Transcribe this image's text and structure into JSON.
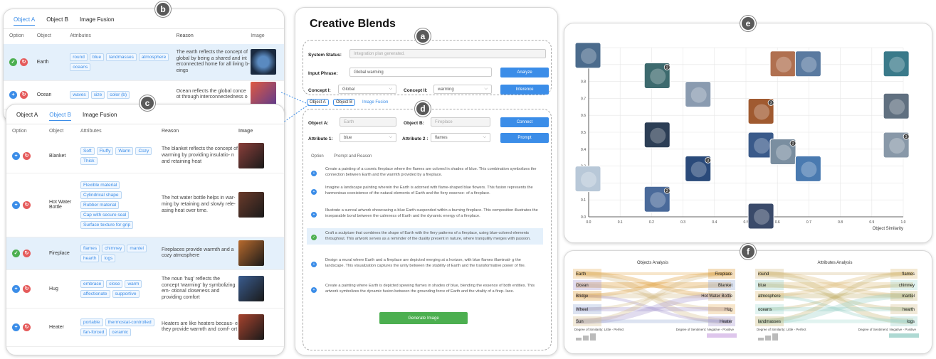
{
  "labels": {
    "a": "a",
    "b": "b",
    "c": "c",
    "d": "d",
    "e": "e",
    "f": "f"
  },
  "panel_b": {
    "tabs": [
      "Object A",
      "Object B",
      "Image Fusion"
    ],
    "headers": [
      "Option",
      "Object",
      "Attributes",
      "Reason",
      "Image"
    ],
    "rows": [
      {
        "object": "Earth",
        "attributes": [
          "round",
          "blue",
          "landmasses",
          "atmosphere",
          "oceans"
        ],
        "reason": "The earth reflects the concept of global by being a shared and int erconnected home for all living b- eings",
        "img": "#3a5d8a"
      },
      {
        "object": "Ocean",
        "attributes": [
          "waves",
          "size",
          "color (b)"
        ],
        "reason": "Ocean reflects the global conce ot through interconnectedness o",
        "img": "#d9583c"
      }
    ]
  },
  "panel_c": {
    "tabs": [
      "Object A",
      "Object B",
      "Image Fusion"
    ],
    "headers": [
      "Option",
      "Object",
      "Attributes",
      "Reason",
      "Image"
    ],
    "rows": [
      {
        "object": "Blanket",
        "attributes": [
          "Soft",
          "Fluffy",
          "Warm",
          "Cozy",
          "Thick"
        ],
        "reason": "The blanket reflects the concept of warming by providing insulatio- n and retaining heat",
        "img": "#8a3f3a"
      },
      {
        "object": "Hot Water Bottle",
        "attributes": [
          "Flexible material",
          "Cylindrical shape",
          "Rubber material",
          "Cap with secure seal",
          "Surface texture for grip"
        ],
        "reason": "The hot water bottle helps in war- ming by retaining and slowly rele- asing heat over time.",
        "img": "#6b3b2b"
      },
      {
        "object": "Fireplace",
        "attributes": [
          "flames",
          "chimney",
          "mantel",
          "hearth",
          "logs"
        ],
        "reason": "Fireplaces provide warmth and a cozy atmosphere",
        "img": "#b86a2d"
      },
      {
        "object": "Hug",
        "attributes": [
          "embrace",
          "close",
          "warm",
          "affectionate",
          "supportive"
        ],
        "reason": "The noun 'hug' reflects the concept 'warming' by symbolizing em- otional closeness and providing comfort",
        "img": "#3a5c8f"
      },
      {
        "object": "Heater",
        "attributes": [
          "portable",
          "thermostat-controlled",
          "fan-forced",
          "ceramic"
        ],
        "reason": "Heaters are like heaters becaus- e they provide warmth and comf- ort",
        "img": "#a8432e"
      }
    ]
  },
  "main": {
    "title": "Creative Blends",
    "status_label": "System Status:",
    "status_value": "Integration plan generated.",
    "phrase_label": "Input Phrase:",
    "phrase_value": "Global warming",
    "analyze": "Analyze",
    "concept1_label": "Concept I:",
    "concept1_value": "Global",
    "concept2_label": "Concept II:",
    "concept2_value": "warming",
    "inference": "Inference",
    "tabs": [
      "Object A",
      "Object B",
      "Image Fusion"
    ],
    "objA_label": "Object A:",
    "objA_value": "Earth",
    "objB_label": "Object B:",
    "objB_value": "Fireplace",
    "connect": "Connect",
    "attr1_label": "Attribute 1:",
    "attr1_value": "blue",
    "attr2_label": "Attribute 2 :",
    "attr2_value": "flames",
    "prompt": "Prompt",
    "list_header_option": "Option",
    "list_header_prompt": "Prompt and Reason",
    "prompts": [
      "Create a painting of a cosmic fireplace where the flames are colored in shades of blue. This combination symbolizes the connection between Earth and the warmth provided by a fireplace.",
      "Imagine a landscape painting wherein the Earth is adorned with flame-shaped blue flowers. This fusion represents the harmonious coexistence of the natural elements of Earth and the fiery essence- of a fireplace.",
      "Illustrate a surreal artwork showcasing a blue Earth suspended within a burning fireplace. This composition illustrates the inseparable bond between the calmness of Earth and the dynamic energy of a fireplace.",
      "Craft a sculpture that combines the shape of Earth with the fiery patterns of a fireplace, using blue-colored elements throughout. This artwork serves as a reminder of the duality present in nature, where tranquility merges with passion.",
      "Design a mural where Earth and a fireplace are depicted merging at a horizon, with blue flames illuminati- g the landscape. This visualization captures the unity between the stability of Earth and the transformative power of fire.",
      "Create a painting where Earth is depicted spewing flames in shades of blue, blending the essence of both entities. This artwork symbolizes the dynamic fusion between the grounding force of Earth and the vitality of a firep- lace."
    ],
    "generate": "Generate Image"
  },
  "scatter": {
    "ylabel": "Attribute",
    "xlabel": "Object Similarity",
    "xticks": [
      "0.0",
      "0.1",
      "0.2",
      "0.3",
      "0.4",
      "0.5",
      "0.6",
      "0.7",
      "0.8",
      "0.9",
      "1.0"
    ],
    "yticks": [
      "0.0",
      "0.1",
      "0.2",
      "0.3",
      "0.4",
      "0.5",
      "0.6",
      "0.7",
      "0.8",
      "0.9",
      "1.0"
    ],
    "points": [
      {
        "x": 0.0,
        "y": 0.95,
        "c": "#4b6b8c",
        "b": ""
      },
      {
        "x": 0.22,
        "y": 0.83,
        "c": "#3d6a6e",
        "b": "2"
      },
      {
        "x": 0.35,
        "y": 0.72,
        "c": "#8a9bb0",
        "b": ""
      },
      {
        "x": 0.62,
        "y": 0.9,
        "c": "#b07050",
        "b": ""
      },
      {
        "x": 0.7,
        "y": 0.9,
        "c": "#5a7aa0",
        "b": ""
      },
      {
        "x": 0.98,
        "y": 0.9,
        "c": "#3a7a8a",
        "b": ""
      },
      {
        "x": 0.98,
        "y": 0.65,
        "c": "#607080",
        "b": ""
      },
      {
        "x": 0.55,
        "y": 0.62,
        "c": "#a05a30",
        "b": "3"
      },
      {
        "x": 0.22,
        "y": 0.48,
        "c": "#2c3e55",
        "b": ""
      },
      {
        "x": 0.55,
        "y": 0.42,
        "c": "#3a5a8a",
        "b": ""
      },
      {
        "x": 0.62,
        "y": 0.38,
        "c": "#7a8ea0",
        "b": "2"
      },
      {
        "x": 0.98,
        "y": 0.42,
        "c": "#8898a8",
        "b": "3"
      },
      {
        "x": 0.35,
        "y": 0.28,
        "c": "#2a4a7a",
        "b": "3"
      },
      {
        "x": 0.7,
        "y": 0.28,
        "c": "#4a7ab0",
        "b": ""
      },
      {
        "x": 0.0,
        "y": 0.22,
        "c": "#b8c8d8",
        "b": ""
      },
      {
        "x": 0.22,
        "y": 0.1,
        "c": "#4a6a9a",
        "b": "2"
      },
      {
        "x": 0.55,
        "y": 0.0,
        "c": "#3a4a6a",
        "b": ""
      }
    ]
  },
  "sankey": {
    "left_title": "Objects Analysis",
    "right_title": "Attributes Analysis",
    "left_a": [
      "Earth",
      "Ocean",
      "Bridge",
      "Wheel",
      "Sun"
    ],
    "left_b": [
      "Fireplace",
      "Blanket",
      "Hot Water Bottle",
      "Hug",
      "Heater"
    ],
    "right_a": [
      "round",
      "blue",
      "atmosphere",
      "oceans",
      "landmasses"
    ],
    "right_b": [
      "flames",
      "chimney",
      "mantel",
      "hearth",
      "logs"
    ],
    "legend_sim": "Degree of Similarity: Little - Perfect",
    "legend_sent": "Degree of Sentiment: Negative - Positive"
  }
}
